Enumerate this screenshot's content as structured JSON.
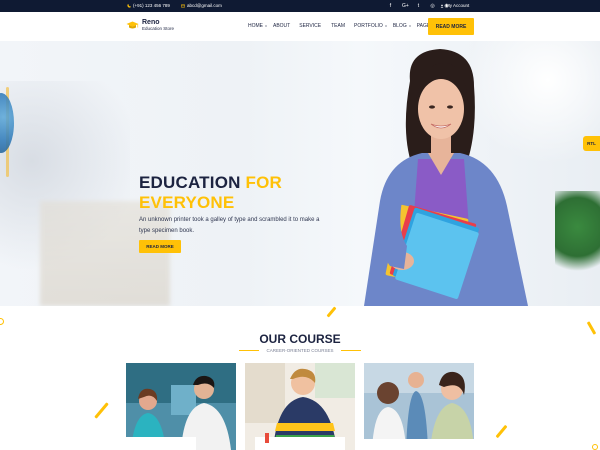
{
  "topbar": {
    "phone": "(+91) 123 456 789",
    "email": "abcd@gmail.com",
    "social_icons": [
      "facebook-icon",
      "google-plus-icon",
      "twitter-icon",
      "instagram-icon",
      "rss-icon"
    ],
    "social_glyphs": [
      "f",
      "G+",
      "t",
      "◎",
      "◉"
    ],
    "account": "My Account"
  },
  "header": {
    "logo_name": "Reno",
    "logo_sub": "Education Store",
    "nav": [
      {
        "label": "HOME",
        "dropdown": true
      },
      {
        "label": "ABOUT",
        "dropdown": false
      },
      {
        "label": "SERVICE",
        "dropdown": false
      },
      {
        "label": "TEAM",
        "dropdown": false
      },
      {
        "label": "PORTFOLIO",
        "dropdown": true
      },
      {
        "label": "BLOG",
        "dropdown": true
      },
      {
        "label": "PAGE",
        "dropdown": true
      }
    ],
    "cta": "READ MORE"
  },
  "hero": {
    "title_line1_a": "EDUCATION ",
    "title_line1_b": "FOR",
    "title_line2": "EVERYONE",
    "description": "An unknown printer took a galley of type and scrambled it to make a type specimen book.",
    "button": "READ MORE",
    "rtl": "RTL"
  },
  "course": {
    "title": "OUR COURSE",
    "subtitle": "CAREER-ORIENTED COURSES"
  },
  "colors": {
    "accent": "#ffc107",
    "navy": "#1c2340",
    "topbar": "#0f1a33"
  }
}
